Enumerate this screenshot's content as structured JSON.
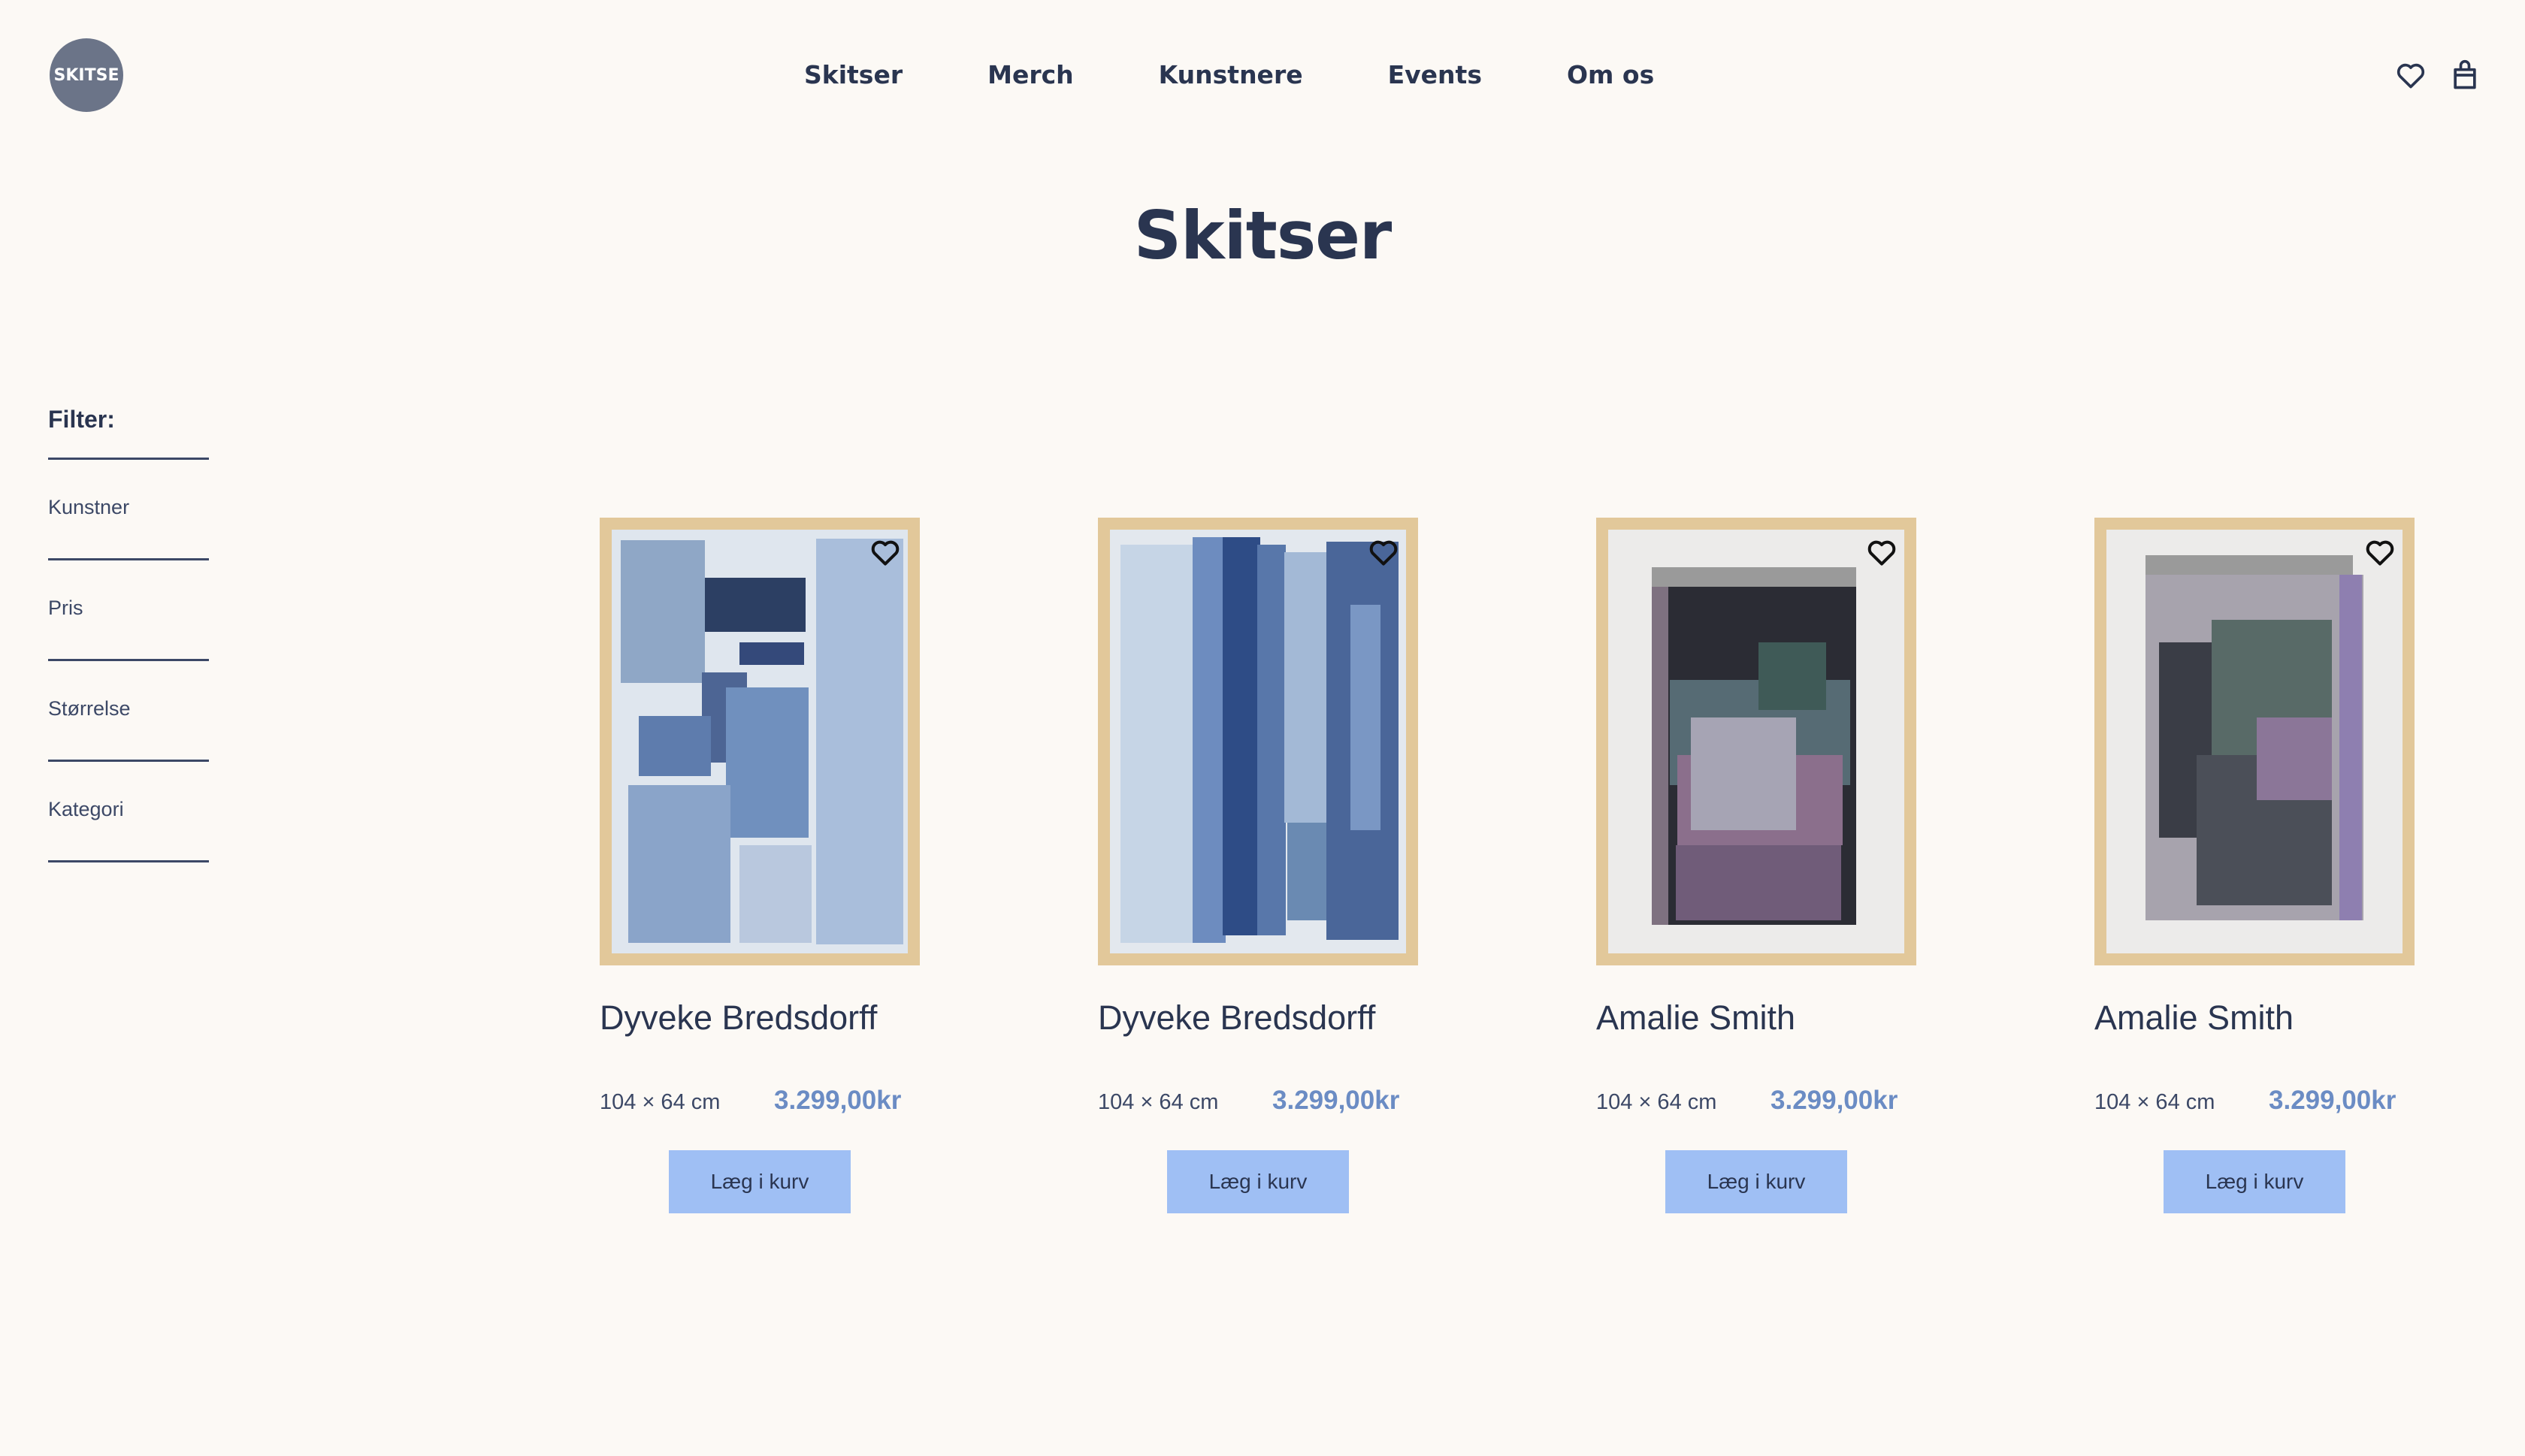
{
  "header": {
    "logo_text": "SKITSE",
    "nav": [
      "Skitser",
      "Merch",
      "Kunstnere",
      "Events",
      "Om os"
    ],
    "icons": [
      "heart-icon",
      "shopping-bag-icon"
    ]
  },
  "page": {
    "title": "Skitser"
  },
  "filter": {
    "heading": "Filter:",
    "items": [
      "Kunstner",
      "Pris",
      "Størrelse",
      "Kategori"
    ]
  },
  "products": [
    {
      "artist": "Dyveke Bredsdorff",
      "size": "104 × 64 cm",
      "price": "3.299,00kr",
      "button": "Læg i kurv"
    },
    {
      "artist": "Dyveke Bredsdorff",
      "size": "104 × 64 cm",
      "price": "3.299,00kr",
      "button": "Læg i kurv"
    },
    {
      "artist": "Amalie Smith",
      "size": "104 × 64 cm",
      "price": "3.299,00kr",
      "button": "Læg i kurv"
    },
    {
      "artist": "Amalie Smith",
      "size": "104 × 64 cm",
      "price": "3.299,00kr",
      "button": "Læg i kurv"
    }
  ],
  "colors": {
    "background": "#fcf9f5",
    "text": "#2a3550",
    "price": "#6b8cc4",
    "button": "#9fbff4",
    "frame": "#e2c89a"
  }
}
